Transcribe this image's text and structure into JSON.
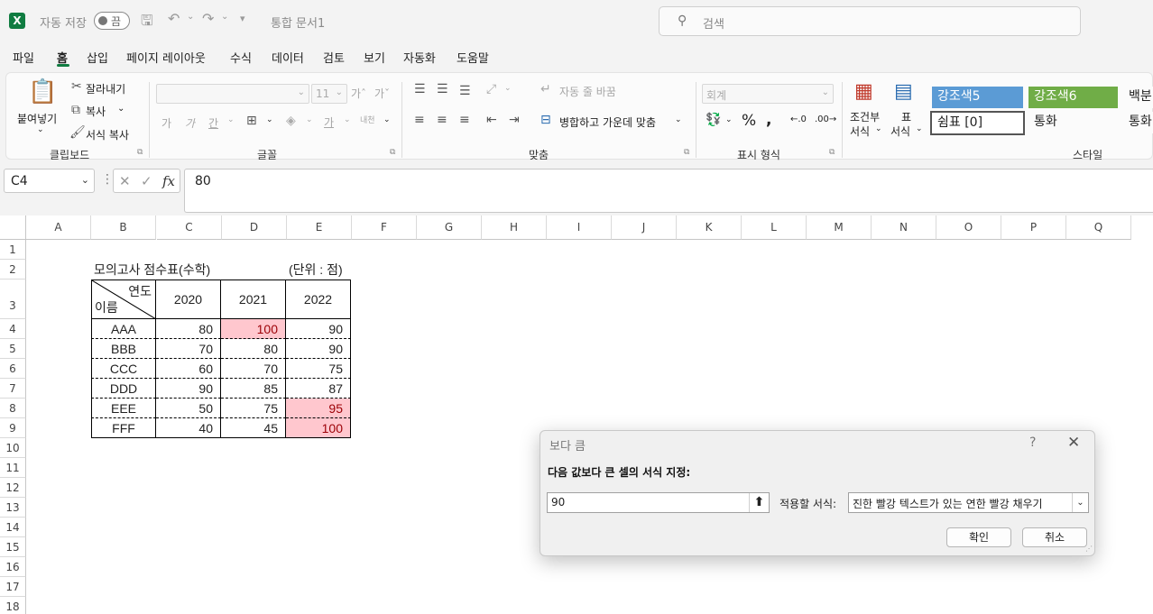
{
  "app": {
    "autosave_label": "자동 저장",
    "autosave_state": "끔",
    "doc_title": "통합 문서1",
    "search_placeholder": "검색"
  },
  "menu": [
    "파일",
    "홈",
    "삽입",
    "페이지 레이아웃",
    "수식",
    "데이터",
    "검토",
    "보기",
    "자동화",
    "도움말"
  ],
  "menu_active": "홈",
  "ribbon": {
    "clipboard": {
      "paste": "붙여넣기",
      "cut": "잘라내기",
      "copy": "복사",
      "format_painter": "서식 복사",
      "group": "클립보드"
    },
    "font": {
      "size": "11",
      "bold": "가",
      "italic": "가",
      "underline": "간",
      "group": "글꼴",
      "font_color_glyph": "가",
      "phonetic": "내천"
    },
    "alignment": {
      "wrap": "자동 줄 바꿈",
      "merge": "병합하고 가운데 맞춤",
      "group": "맞춤"
    },
    "number": {
      "format": "회계",
      "group": "표시 형식"
    },
    "styles": {
      "conditional": [
        "조건부",
        "서식"
      ],
      "table": [
        "표",
        "서식"
      ],
      "cells": [
        {
          "label": "강조색5",
          "bg": "#5b9bd5",
          "fg": "#ffffff"
        },
        {
          "label": "강조색6",
          "bg": "#70ad47",
          "fg": "#ffffff"
        },
        {
          "label": "백분",
          "bg": "#fbfbfb",
          "fg": "#222222"
        },
        {
          "label": "쉼표 [0]",
          "bg": "#ffffff",
          "fg": "#222222"
        },
        {
          "label": "통화",
          "bg": "#fbfbfb",
          "fg": "#222222"
        },
        {
          "label": "통화",
          "bg": "#fbfbfb",
          "fg": "#222222"
        }
      ],
      "group": "스타일"
    }
  },
  "formula_bar": {
    "name_box": "C4",
    "value": "80",
    "fx": "fx"
  },
  "columns": [
    "A",
    "B",
    "C",
    "D",
    "E",
    "F",
    "G",
    "H",
    "I",
    "J",
    "K",
    "L",
    "M",
    "N",
    "O",
    "P",
    "Q"
  ],
  "rows": [
    "1",
    "2",
    "3",
    "4",
    "5",
    "6",
    "7",
    "8",
    "9",
    "10",
    "11",
    "12",
    "13",
    "14",
    "15",
    "16",
    "17",
    "18"
  ],
  "sheet": {
    "title": "모의고사 점수표(수학)",
    "unit": "(단위 : 점)",
    "header_top": "연도",
    "header_bottom": "이름",
    "years": [
      "2020",
      "2021",
      "2022"
    ],
    "records": [
      {
        "name": "AAA",
        "values": [
          "80",
          "100",
          "90"
        ],
        "highlight": [
          false,
          true,
          false
        ]
      },
      {
        "name": "BBB",
        "values": [
          "70",
          "80",
          "90"
        ],
        "highlight": [
          false,
          false,
          false
        ]
      },
      {
        "name": "CCC",
        "values": [
          "60",
          "70",
          "75"
        ],
        "highlight": [
          false,
          false,
          false
        ]
      },
      {
        "name": "DDD",
        "values": [
          "90",
          "85",
          "87"
        ],
        "highlight": [
          false,
          false,
          false
        ]
      },
      {
        "name": "EEE",
        "values": [
          "50",
          "75",
          "95"
        ],
        "highlight": [
          false,
          false,
          true
        ]
      },
      {
        "name": "FFF",
        "values": [
          "40",
          "45",
          "100"
        ],
        "highlight": [
          false,
          false,
          true
        ]
      }
    ],
    "highlight_bg": "#ffc7ce",
    "highlight_fg": "#9c0006"
  },
  "dialog": {
    "title": "보다 큼",
    "help": "?",
    "prompt": "다음 값보다 큰 셀의 서식 지정:",
    "value": "90",
    "format_label": "적용할 서식:",
    "format_value": "진한 빨강 텍스트가 있는 연한 빨강 채우기",
    "ok": "확인",
    "cancel": "취소"
  }
}
